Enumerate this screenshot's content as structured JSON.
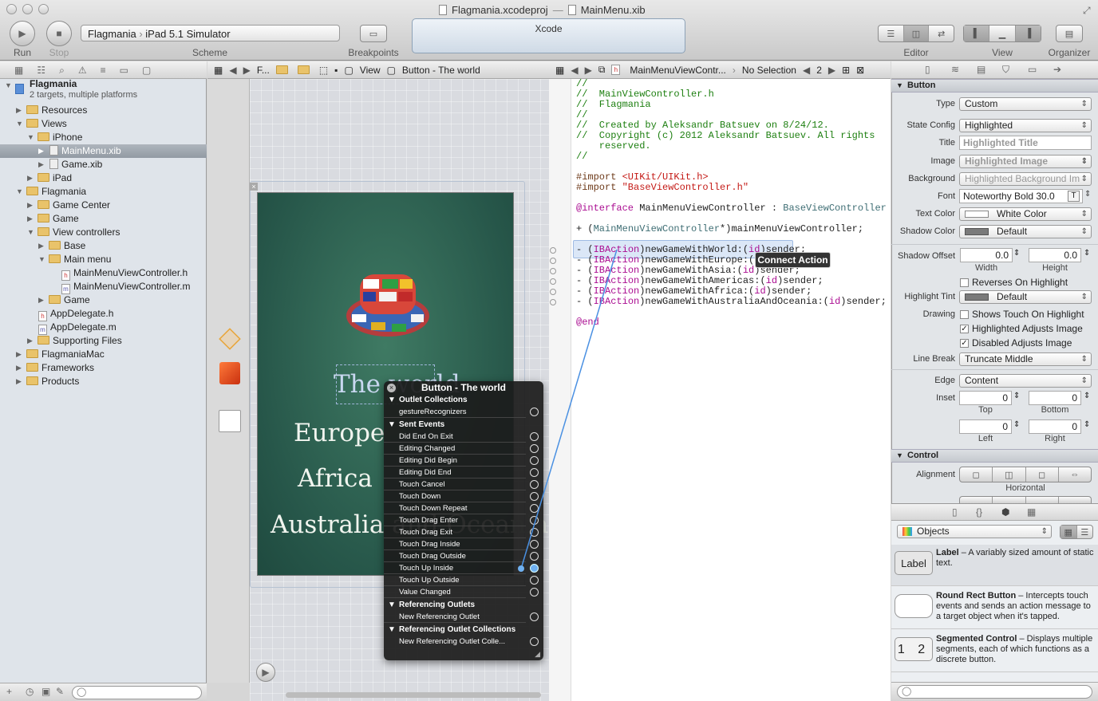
{
  "window": {
    "title_project": "Flagmania.xcodeproj",
    "title_file": "MainMenu.xib"
  },
  "toolbar": {
    "run": "Run",
    "stop": "Stop",
    "scheme_target": "Flagmania",
    "scheme_device": "iPad 5.1 Simulator",
    "scheme_label": "Scheme",
    "breakpoints": "Breakpoints",
    "activity": "Xcode",
    "editor": "Editor",
    "view": "View",
    "organizer": "Organizer"
  },
  "navigator": {
    "items": [
      {
        "label": "Flagmania",
        "sub": "2 targets, multiple platforms"
      },
      {
        "label": "Resources"
      },
      {
        "label": "Views"
      },
      {
        "label": "iPhone"
      },
      {
        "label": "MainMenu.xib"
      },
      {
        "label": "Game.xib"
      },
      {
        "label": "iPad"
      },
      {
        "label": "Flagmania"
      },
      {
        "label": "Game Center"
      },
      {
        "label": "Game"
      },
      {
        "label": "View controllers"
      },
      {
        "label": "Base"
      },
      {
        "label": "Main menu"
      },
      {
        "label": "MainMenuViewController.h"
      },
      {
        "label": "MainMenuViewController.m"
      },
      {
        "label": "Game"
      },
      {
        "label": "AppDelegate.h"
      },
      {
        "label": "AppDelegate.m"
      },
      {
        "label": "Supporting Files"
      },
      {
        "label": "FlagmaniaMac"
      },
      {
        "label": "Frameworks"
      },
      {
        "label": "Products"
      }
    ]
  },
  "ib_jumpbar": {
    "crumb1": "F...",
    "view": "View",
    "button": "Button - The world"
  },
  "code_jumpbar": {
    "file": "MainMenuViewContr...",
    "selection": "No Selection",
    "counter": "2"
  },
  "screen": {
    "line1": "The world",
    "line2": "Europe",
    "line3": "Africa",
    "line4": "Australia and Oceania"
  },
  "connections": {
    "title": "Button - The world",
    "outlet_collections": "Outlet Collections",
    "gesture": "gestureRecognizers",
    "sent_events": "Sent Events",
    "events": [
      "Did End On Exit",
      "Editing Changed",
      "Editing Did Begin",
      "Editing Did End",
      "Touch Cancel",
      "Touch Down",
      "Touch Down Repeat",
      "Touch Drag Enter",
      "Touch Drag Exit",
      "Touch Drag Inside",
      "Touch Drag Outside",
      "Touch Up Inside",
      "Touch Up Outside",
      "Value Changed"
    ],
    "referencing_outlets": "Referencing Outlets",
    "new_ref_outlet": "New Referencing Outlet",
    "referencing_collections": "Referencing Outlet Collections",
    "new_ref_collection": "New Referencing Outlet Colle..."
  },
  "code": {
    "c1": "//",
    "c2": "//  MainViewController.h",
    "c3": "//  Flagmania",
    "c4": "//",
    "c5": "//  Created by Aleksandr Batsuev on 8/24/12.",
    "c6": "//  Copyright (c) 2012 Aleksandr Batsuev. All rights",
    "c7": "    reserved.",
    "c8": "//",
    "imp1a": "#import ",
    "imp1b": "<UIKit/UIKit.h>",
    "imp2a": "#import ",
    "imp2b": "\"BaseViewController.h\"",
    "ifa": "@interface",
    "ifb": " MainMenuViewController : ",
    "ifc": "BaseViewController",
    "propa": "+ (",
    "propb": "MainMenuViewController",
    "propc": "*)mainMenuViewController;",
    "m1": "newGameWithWorld:",
    "m2": "newGameWithEurope:",
    "m3": "newGameWithAsia:",
    "m4": "newGameWithAmericas:",
    "m5": "newGameWithAfrica:",
    "m6": "newGameWithAustraliaAndOceania:",
    "ibaction": "IBAction",
    "id": "id",
    "sender": ")sender;",
    "end": "@end",
    "connect_tip": "Connect Action"
  },
  "inspector": {
    "section": "Button",
    "type_label": "Type",
    "type": "Custom",
    "state_label": "State Config",
    "state": "Highlighted",
    "title_label": "Title",
    "title_ph": "Highlighted Title",
    "image_label": "Image",
    "image_ph": "Highlighted Image",
    "bg_label": "Background",
    "bg_ph": "Highlighted Background Im",
    "font_label": "Font",
    "font": "Noteworthy Bold 30.0",
    "textcolor_label": "Text Color",
    "textcolor": "White Color",
    "shadowcolor_label": "Shadow Color",
    "shadowcolor": "Default",
    "shadowoffset_label": "Shadow Offset",
    "off_w": "0.0",
    "off_h": "0.0",
    "width": "Width",
    "height": "Height",
    "reverses": "Reverses On Highlight",
    "tint_label": "Highlight Tint",
    "tint": "Default",
    "drawing_label": "Drawing",
    "shows_touch": "Shows Touch On Highlight",
    "adj_img": "Highlighted Adjusts Image",
    "dis_img": "Disabled Adjusts Image",
    "linebreak_label": "Line Break",
    "linebreak": "Truncate Middle",
    "edge_label": "Edge",
    "edge": "Content",
    "inset_label": "Inset",
    "top": "Top",
    "bottom": "Bottom",
    "left": "Left",
    "right": "Right",
    "zero": "0",
    "control_section": "Control",
    "alignment_label": "Alignment",
    "horizontal": "Horizontal"
  },
  "library": {
    "filter": "Objects",
    "items": [
      {
        "icon": "Label",
        "name": "Label",
        "desc": " – A variably sized amount of static text."
      },
      {
        "icon": "",
        "name": "Round Rect Button",
        "desc": " – Intercepts touch events and sends an action message to a target object when it's tapped."
      },
      {
        "icon": "1 2",
        "name": "Segmented Control",
        "desc": " – Displays multiple segments, each of which functions as a discrete button."
      }
    ]
  }
}
